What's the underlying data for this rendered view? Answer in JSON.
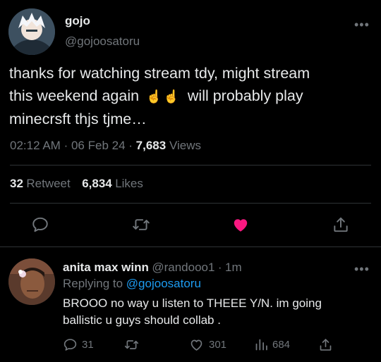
{
  "tweet": {
    "author_name": "gojo",
    "author_handle": "@gojoosatoru",
    "more_icon": "•••",
    "text_line1": "thanks for watching stream tdy, might stream",
    "text_line2_a": "this weekend again",
    "emoji": "☝️",
    "text_line2_b": "will probably play",
    "text_line3": "minecrsft thjs tjme…",
    "time": "02:12 AM",
    "sep": "·",
    "date": "06 Feb 24",
    "views_count": "7,683",
    "views_label": "Views",
    "retweet_count": "32",
    "retweet_label": "Retweet",
    "likes_count": "6,834",
    "likes_label": "Likes",
    "icons": [
      "reply-icon",
      "retweet-icon",
      "heart-icon",
      "share-icon"
    ],
    "liked_color": "#f91880"
  },
  "reply": {
    "author_name": "anita max winn",
    "author_handle": "@randooo1",
    "sep": "·",
    "time_ago": "1m",
    "replying_to_label": "Replying to",
    "replying_to_handle": "@gojoosatoru",
    "text_line1": "BROOO no way u listen to THEEE Y/N. im going",
    "text_line2": "ballistic u guys should collab .",
    "more_icon": "•••",
    "reply_count": "31",
    "like_count": "301",
    "view_count": "684"
  },
  "colors": {
    "background": "#000000",
    "text": "#e7e9ea",
    "secondary": "#71767b",
    "divider": "#2f3336",
    "link": "#1d9bf0"
  }
}
